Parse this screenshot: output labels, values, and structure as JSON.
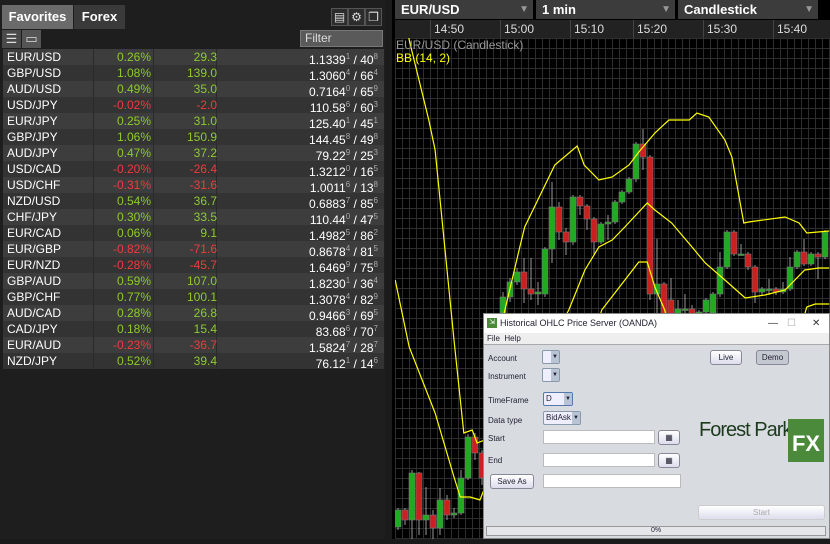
{
  "watchlist": {
    "tabs": [
      {
        "label": "Favorites",
        "active": true
      },
      {
        "label": "Forex",
        "active": false
      }
    ],
    "filter_placeholder": "Filter",
    "icons": [
      "export-icon",
      "gear-icon",
      "popout-icon",
      "list-view-icon",
      "tile-view-icon"
    ],
    "rows": [
      {
        "pair": "EUR/USD",
        "pct": "0.26%",
        "chg": "29.3",
        "dir": "up",
        "bid": "1.1339",
        "bid_pip": "1",
        "ask": "40",
        "ask_pip": "8"
      },
      {
        "pair": "GBP/USD",
        "pct": "1.08%",
        "chg": "139.0",
        "dir": "up",
        "bid": "1.3060",
        "bid_pip": "4",
        "ask": "66",
        "ask_pip": "4"
      },
      {
        "pair": "AUD/USD",
        "pct": "0.49%",
        "chg": "35.0",
        "dir": "up",
        "bid": "0.7164",
        "bid_pip": "0",
        "ask": "65",
        "ask_pip": "9"
      },
      {
        "pair": "USD/JPY",
        "pct": "-0.02%",
        "chg": "-2.0",
        "dir": "dn",
        "bid": "110.58",
        "bid_pip": "6",
        "ask": "60",
        "ask_pip": "3"
      },
      {
        "pair": "EUR/JPY",
        "pct": "0.25%",
        "chg": "31.0",
        "dir": "up",
        "bid": "125.40",
        "bid_pip": "1",
        "ask": "45",
        "ask_pip": "1"
      },
      {
        "pair": "GBP/JPY",
        "pct": "1.06%",
        "chg": "150.9",
        "dir": "up",
        "bid": "144.45",
        "bid_pip": "8",
        "ask": "49",
        "ask_pip": "8"
      },
      {
        "pair": "AUD/JPY",
        "pct": "0.47%",
        "chg": "37.2",
        "dir": "up",
        "bid": "79.22",
        "bid_pip": "9",
        "ask": "25",
        "ask_pip": "3"
      },
      {
        "pair": "USD/CAD",
        "pct": "-0.20%",
        "chg": "-26.4",
        "dir": "dn",
        "bid": "1.3212",
        "bid_pip": "0",
        "ask": "16",
        "ask_pip": "5"
      },
      {
        "pair": "USD/CHF",
        "pct": "-0.31%",
        "chg": "-31.6",
        "dir": "dn",
        "bid": "1.0011",
        "bid_pip": "6",
        "ask": "13",
        "ask_pip": "8"
      },
      {
        "pair": "NZD/USD",
        "pct": "0.54%",
        "chg": "36.7",
        "dir": "up",
        "bid": "0.6883",
        "bid_pip": "7",
        "ask": "85",
        "ask_pip": "6"
      },
      {
        "pair": "CHF/JPY",
        "pct": "0.30%",
        "chg": "33.5",
        "dir": "up",
        "bid": "110.44",
        "bid_pip": "0",
        "ask": "47",
        "ask_pip": "5"
      },
      {
        "pair": "EUR/CAD",
        "pct": "0.06%",
        "chg": "9.1",
        "dir": "up",
        "bid": "1.4982",
        "bid_pip": "5",
        "ask": "86",
        "ask_pip": "2"
      },
      {
        "pair": "EUR/GBP",
        "pct": "-0.82%",
        "chg": "-71.6",
        "dir": "dn",
        "bid": "0.8678",
        "bid_pip": "4",
        "ask": "81",
        "ask_pip": "5"
      },
      {
        "pair": "EUR/NZD",
        "pct": "-0.28%",
        "chg": "-45.7",
        "dir": "dn",
        "bid": "1.6469",
        "bid_pip": "9",
        "ask": "75",
        "ask_pip": "8"
      },
      {
        "pair": "GBP/AUD",
        "pct": "0.59%",
        "chg": "107.0",
        "dir": "up",
        "bid": "1.8230",
        "bid_pip": "1",
        "ask": "36",
        "ask_pip": "4"
      },
      {
        "pair": "GBP/CHF",
        "pct": "0.77%",
        "chg": "100.1",
        "dir": "up",
        "bid": "1.3078",
        "bid_pip": "4",
        "ask": "82",
        "ask_pip": "9"
      },
      {
        "pair": "AUD/CAD",
        "pct": "0.28%",
        "chg": "26.8",
        "dir": "up",
        "bid": "0.9466",
        "bid_pip": "3",
        "ask": "69",
        "ask_pip": "5"
      },
      {
        "pair": "CAD/JPY",
        "pct": "0.18%",
        "chg": "15.4",
        "dir": "up",
        "bid": "83.68",
        "bid_pip": "6",
        "ask": "70",
        "ask_pip": "7"
      },
      {
        "pair": "EUR/AUD",
        "pct": "-0.23%",
        "chg": "-36.7",
        "dir": "dn",
        "bid": "1.5824",
        "bid_pip": "7",
        "ask": "28",
        "ask_pip": "7"
      },
      {
        "pair": "NZD/JPY",
        "pct": "0.52%",
        "chg": "39.4",
        "dir": "up",
        "bid": "76.12",
        "bid_pip": "1",
        "ask": "14",
        "ask_pip": "6"
      }
    ]
  },
  "chart": {
    "instrument": "EUR/USD",
    "interval": "1 min",
    "style": "Candlestick",
    "series_label": "EUR/USD (Candlestick)",
    "indicator_label": "BB (14, 2)",
    "time_labels": [
      "14:50",
      "15:00",
      "15:10",
      "15:20",
      "15:30",
      "15:40"
    ],
    "colors": {
      "up": "#1faa1f",
      "down": "#cc1f1f",
      "band": "#ffff00",
      "wick": "#999999"
    }
  },
  "chart_data": {
    "type": "candlestick",
    "note_units": "relative price (no price axis shown)",
    "candles": [
      [
        13,
        32,
        10,
        30
      ],
      [
        30,
        32,
        15,
        20
      ],
      [
        20,
        70,
        0,
        67
      ],
      [
        67,
        68,
        5,
        20
      ],
      [
        20,
        53,
        5,
        25
      ],
      [
        25,
        30,
        0,
        12
      ],
      [
        12,
        52,
        5,
        40
      ],
      [
        40,
        45,
        20,
        25
      ],
      [
        25,
        32,
        22,
        27
      ],
      [
        27,
        70,
        25,
        62
      ],
      [
        62,
        106,
        60,
        103
      ],
      [
        103,
        107,
        80,
        87
      ],
      [
        87,
        90,
        55,
        62
      ],
      [
        62,
        110,
        60,
        103
      ],
      [
        103,
        150,
        100,
        145
      ],
      [
        227,
        248,
        220,
        243
      ],
      [
        243,
        262,
        238,
        258
      ],
      [
        258,
        272,
        255,
        268
      ],
      [
        268,
        282,
        237,
        251
      ],
      [
        251,
        282,
        240,
        246
      ],
      [
        246,
        258,
        235,
        248
      ],
      [
        246,
        293,
        243,
        291
      ],
      [
        291,
        358,
        277,
        333
      ],
      [
        333,
        338,
        300,
        308
      ],
      [
        308,
        312,
        285,
        298
      ],
      [
        298,
        345,
        295,
        343
      ],
      [
        343,
        345,
        325,
        334
      ],
      [
        334,
        336,
        310,
        321
      ],
      [
        321,
        323,
        285,
        298
      ],
      [
        298,
        318,
        296,
        316
      ],
      [
        316,
        325,
        300,
        318
      ],
      [
        318,
        340,
        316,
        338
      ],
      [
        338,
        350,
        336,
        348
      ],
      [
        348,
        363,
        346,
        361
      ],
      [
        361,
        398,
        358,
        396
      ],
      [
        396,
        411,
        370,
        383
      ],
      [
        383,
        385,
        240,
        246
      ],
      [
        246,
        301,
        227,
        256
      ],
      [
        256,
        258,
        200,
        215
      ],
      [
        240,
        262,
        200,
        210
      ],
      [
        225,
        240,
        215,
        231
      ],
      [
        231,
        246,
        220,
        231
      ],
      [
        231,
        235,
        210,
        220
      ],
      [
        215,
        230,
        210,
        228
      ],
      [
        228,
        242,
        225,
        240
      ],
      [
        227,
        248,
        222,
        246
      ],
      [
        246,
        288,
        243,
        273
      ],
      [
        273,
        310,
        271,
        308
      ],
      [
        308,
        310,
        284,
        286
      ],
      [
        286,
        296,
        284,
        286
      ],
      [
        286,
        288,
        270,
        273
      ],
      [
        273,
        275,
        237,
        248
      ],
      [
        248,
        253,
        245,
        251
      ],
      [
        251,
        261,
        245,
        251
      ],
      [
        251,
        253,
        245,
        248
      ],
      [
        248,
        258,
        246,
        251
      ],
      [
        251,
        283,
        249,
        273
      ],
      [
        273,
        290,
        271,
        288
      ],
      [
        288,
        301,
        274,
        276
      ],
      [
        276,
        288,
        274,
        286
      ],
      [
        286,
        288,
        261,
        283
      ],
      [
        283,
        310,
        281,
        308
      ]
    ],
    "bollinger": {
      "upper": [
        [
          0,
          570
        ],
        [
          1.6,
          500
        ],
        [
          4.4,
          420
        ],
        [
          5.3,
          390
        ],
        [
          8,
          200
        ],
        [
          9.4,
          107
        ],
        [
          10.6,
          110
        ],
        [
          11.3,
          97
        ],
        [
          12.4,
          100
        ],
        [
          14.6,
          210
        ],
        [
          17.3,
          290
        ],
        [
          18.1,
          313
        ],
        [
          22.4,
          375
        ],
        [
          25.6,
          394
        ],
        [
          26.6,
          375
        ],
        [
          28.7,
          360
        ],
        [
          30.6,
          363
        ],
        [
          33,
          375
        ],
        [
          34.4,
          388
        ],
        [
          36.7,
          407
        ],
        [
          38.7,
          420
        ],
        [
          41.6,
          420
        ],
        [
          42.7,
          427
        ],
        [
          44.4,
          423
        ],
        [
          46.7,
          400
        ],
        [
          47.7,
          383
        ],
        [
          49.4,
          317
        ],
        [
          50.1,
          318
        ],
        [
          55.3,
          323
        ],
        [
          57.3,
          317
        ],
        [
          58.4,
          307
        ],
        [
          61.6,
          309
        ]
      ],
      "middle": [
        [
          -0.4,
          260
        ],
        [
          1.6,
          193
        ],
        [
          5.3,
          127
        ],
        [
          8,
          63
        ],
        [
          8.9,
          43
        ],
        [
          10.3,
          43
        ],
        [
          11.7,
          40
        ],
        [
          18,
          150
        ],
        [
          24.4,
          230
        ],
        [
          26.7,
          270
        ],
        [
          28.7,
          293
        ],
        [
          30.6,
          300
        ],
        [
          32.4,
          313
        ],
        [
          35.6,
          337
        ],
        [
          36.7,
          330
        ],
        [
          39.1,
          317
        ],
        [
          42,
          293
        ],
        [
          43.9,
          277
        ],
        [
          46.7,
          260
        ],
        [
          49.6,
          242
        ],
        [
          52.4,
          245
        ],
        [
          55.3,
          250
        ],
        [
          58.1,
          270
        ],
        [
          60.1,
          272
        ],
        [
          61.6,
          272
        ]
      ],
      "lower": [
        [
          26,
          150
        ],
        [
          29.1,
          230
        ],
        [
          34.4,
          278
        ],
        [
          35.6,
          278
        ],
        [
          36.7,
          253
        ],
        [
          38.1,
          230
        ],
        [
          41,
          150
        ],
        [
          55,
          150
        ],
        [
          58.4,
          233
        ],
        [
          59.6,
          236
        ],
        [
          61.6,
          236
        ]
      ]
    }
  },
  "dialog": {
    "title": "Historical OHLC Price Server (OANDA)",
    "menu": [
      "File",
      "Help"
    ],
    "labels": {
      "account": "Account",
      "instrument": "Instrument",
      "timeframe": "TimeFrame",
      "datatype": "Data type"
    },
    "timeframe_value": "D",
    "datatype_value": "BidAsk",
    "start_label": "Start",
    "end_label": "End",
    "save_as": "Save As",
    "live": "Live",
    "demo": "Demo",
    "start_button": "Start",
    "logo_text": "Forest Park",
    "logo_fx": "FX",
    "progress": "0%",
    "progress_value": 0
  }
}
